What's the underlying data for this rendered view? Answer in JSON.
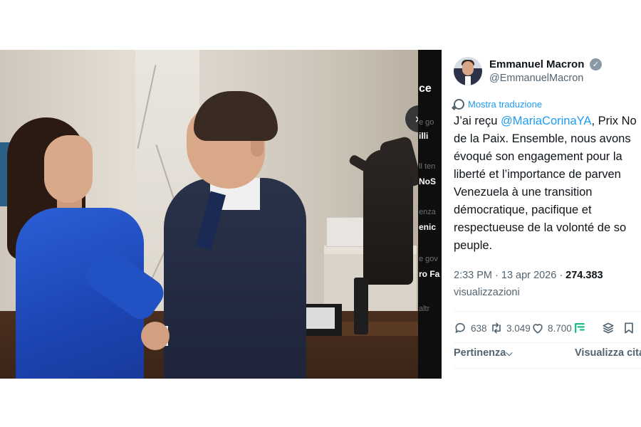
{
  "media": {
    "next_icon": "chevron-double-right-icon",
    "next_glyph": "»"
  },
  "strip_fragments": [
    {
      "text": "ce",
      "style": "big"
    },
    {
      "text": "e go",
      "style": "dim"
    },
    {
      "text": "illi",
      "style": "bold"
    },
    {
      "text": "ll ten",
      "style": "dim"
    },
    {
      "text": "NoS",
      "style": "bold"
    },
    {
      "text": "enza",
      "style": "dim"
    },
    {
      "text": "enic",
      "style": "bold"
    },
    {
      "text": "e gov",
      "style": "dim"
    },
    {
      "text": "ro Fa",
      "style": "bold"
    },
    {
      "text": "altr",
      "style": "dim"
    }
  ],
  "tweet": {
    "author_name": "Emmanuel Macron",
    "author_handle": "@EmmanuelMacron",
    "verified_icon": "verified-badge-icon",
    "translate_label": "Mostra traduzione",
    "text_lines": [
      {
        "pre": "J’ai reçu ",
        "mention": "@MariaCorinaYA",
        "post": ", Prix No"
      },
      {
        "pre": "de la Paix. Ensemble, nous avons"
      },
      {
        "pre": "évoqué son engagement pour la"
      },
      {
        "pre": "liberté et l’importance de parven"
      },
      {
        "pre": "Venezuela à une transition"
      },
      {
        "pre": "démocratique, pacifique et"
      },
      {
        "pre": "respectueuse de la volonté de so"
      },
      {
        "pre": "peuple."
      }
    ],
    "time": "2:33 PM · 13 apr 2026 · ",
    "views_count": "274.383",
    "views_label": "visualizzazioni",
    "actions": {
      "replies": "638",
      "reposts": "3.049",
      "likes": "8.700"
    },
    "tabs": {
      "relevance": "Pertinenza",
      "relevance_glyph": "⌵",
      "quotes": "Visualizza cita"
    }
  },
  "colors": {
    "accent": "#1d9bf0",
    "secondary_text": "#536471",
    "primary_text": "#0f1419",
    "verified_badge": "#8b98a5",
    "jacket_blue": "#2251c4",
    "strip": "#0e0e0f"
  }
}
